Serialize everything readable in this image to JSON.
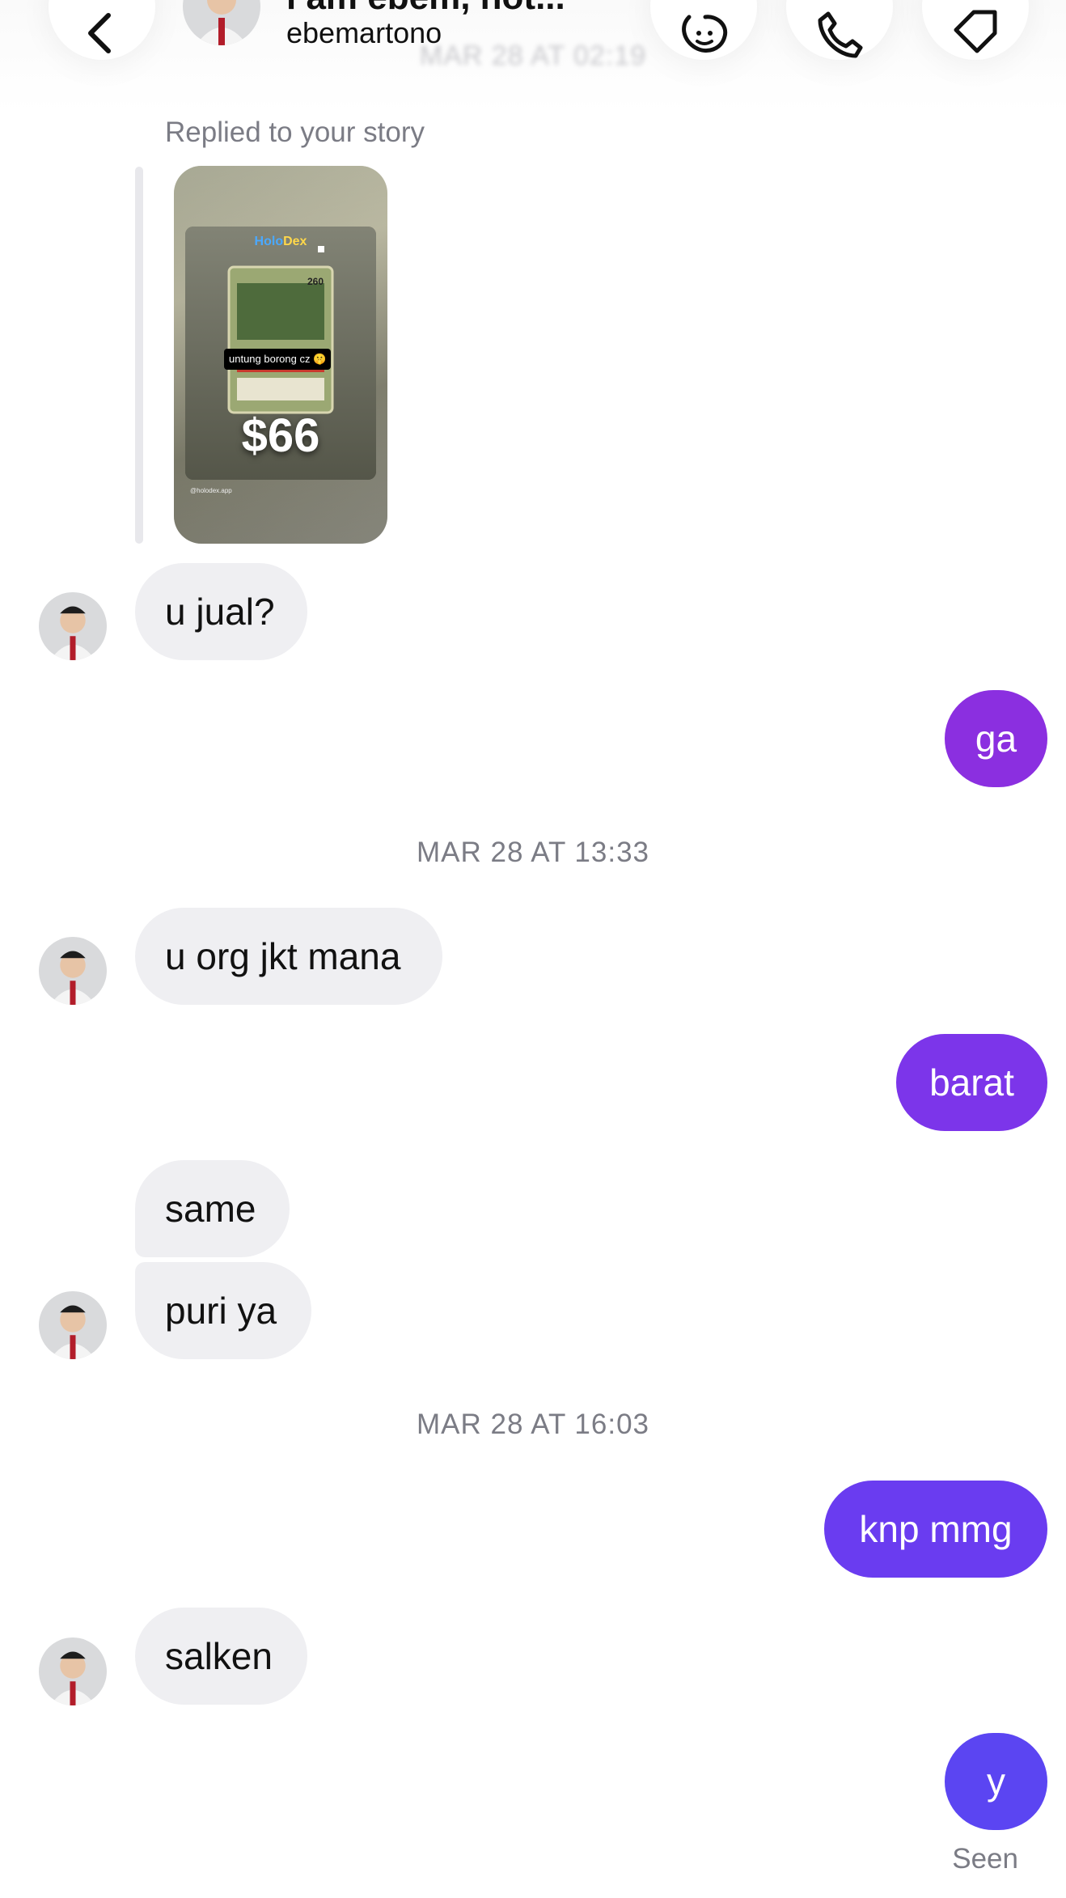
{
  "header": {
    "name": "l am ebem, not...",
    "username": "ebemartono",
    "ghost_timestamp": "MAR 28 AT 02:19"
  },
  "icons": {
    "back": "chevron-left-icon",
    "video": "video-call-icon",
    "call": "phone-icon",
    "tag": "tag-icon"
  },
  "story": {
    "label": "Replied to your story",
    "app_name_left": "Holo",
    "app_name_right": "Dex",
    "card_hp": "260",
    "caption": "untung borong cz 🤫",
    "price": "$66",
    "watermark": "@holodex.app"
  },
  "messages": [
    {
      "side": "in",
      "text": "u jual?"
    },
    {
      "side": "out",
      "text": "ga",
      "color": "#8b2fe0"
    },
    {
      "type": "timestamp",
      "text": "MAR 28 AT 13:33"
    },
    {
      "side": "in",
      "text": "u org jkt mana"
    },
    {
      "side": "out",
      "text": "barat",
      "color": "#7c35ea"
    },
    {
      "side": "in",
      "text": "same"
    },
    {
      "side": "in",
      "text": "puri ya"
    },
    {
      "type": "timestamp",
      "text": "MAR 28 AT 16:03"
    },
    {
      "side": "out",
      "text": "knp mmg",
      "color": "#6a3cf0"
    },
    {
      "side": "in",
      "text": "salken"
    },
    {
      "side": "out",
      "text": "y",
      "color": "#5b45f2"
    }
  ],
  "status": {
    "seen": "Seen"
  }
}
